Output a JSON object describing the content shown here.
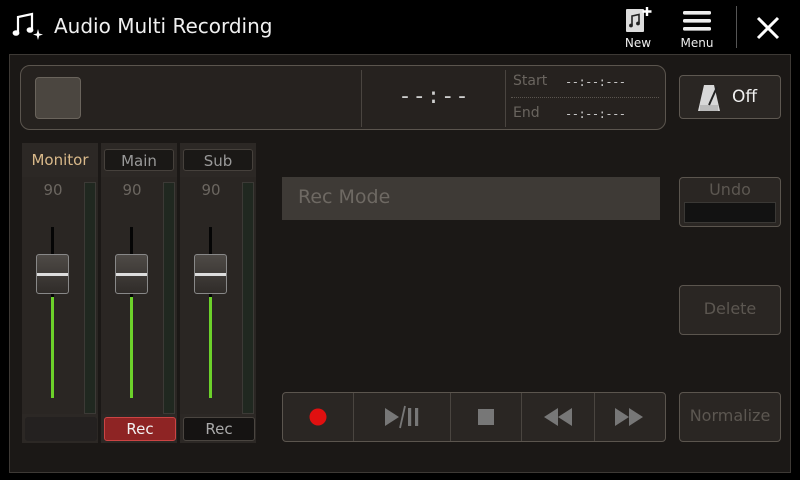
{
  "header": {
    "title": "Audio Multi Recording",
    "new_label": "New",
    "menu_label": "Menu"
  },
  "info": {
    "time": "--:--",
    "start_label": "Start",
    "start_value": "--:--:---",
    "end_label": "End",
    "end_value": "--:--:---"
  },
  "metronome": {
    "label": "Off"
  },
  "mixer": {
    "channels": [
      {
        "name": "Monitor",
        "value": "90",
        "rec": ""
      },
      {
        "name": "Main",
        "value": "90",
        "rec": "Rec"
      },
      {
        "name": "Sub",
        "value": "90",
        "rec": "Rec"
      }
    ]
  },
  "rec_mode": {
    "label": "Rec Mode"
  },
  "buttons": {
    "undo": "Undo",
    "delete": "Delete",
    "normalize": "Normalize"
  },
  "colors": {
    "rec_active": "#8e2424",
    "fader_level": "#6cd12a",
    "record_dot": "#e01010"
  }
}
